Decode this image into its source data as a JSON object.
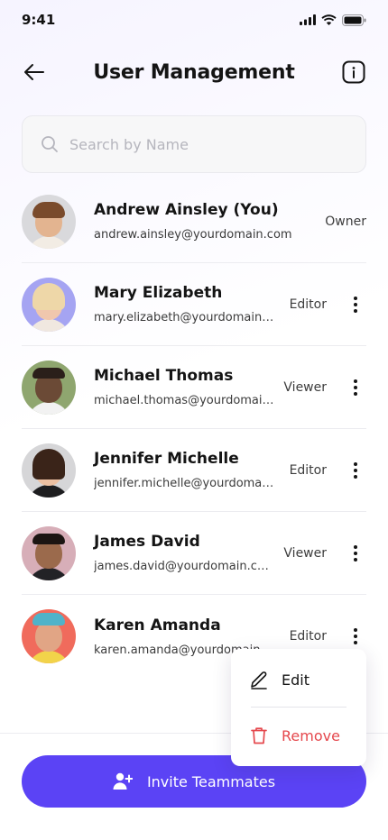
{
  "status_bar": {
    "time": "9:41",
    "icons": [
      "signal-icon",
      "wifi-icon",
      "battery-icon"
    ]
  },
  "header": {
    "title": "User Management",
    "back_icon": "arrow-left-icon",
    "info_icon": "info-icon"
  },
  "search": {
    "placeholder": "Search by Name",
    "value": "",
    "icon": "search-icon"
  },
  "users": [
    {
      "name": "Andrew Ainsley (You)",
      "email": "andrew.ainsley@yourdomain.com",
      "role": "Owner",
      "has_menu": false,
      "avatar_bg": "#d9d9dc"
    },
    {
      "name": "Mary Elizabeth",
      "email": "mary.elizabeth@yourdomain.com",
      "role": "Editor",
      "has_menu": true,
      "avatar_bg": "#a5a4f2"
    },
    {
      "name": "Michael Thomas",
      "email": "michael.thomas@yourdomain.com",
      "role": "Viewer",
      "has_menu": true,
      "avatar_bg": "#8fa66f"
    },
    {
      "name": "Jennifer Michelle",
      "email": "jennifer.michelle@yourdomain.com",
      "role": "Editor",
      "has_menu": true,
      "avatar_bg": "#d6d6d8"
    },
    {
      "name": "James David",
      "email": "james.david@yourdomain.com",
      "role": "Viewer",
      "has_menu": true,
      "avatar_bg": "#d7aeb8"
    },
    {
      "name": "Karen Amanda",
      "email": "karen.amanda@yourdomain.com",
      "role": "Editor",
      "has_menu": true,
      "avatar_bg": "#f06b5c"
    }
  ],
  "context_menu": {
    "edit_label": "Edit",
    "edit_icon": "pencil-icon",
    "remove_label": "Remove",
    "remove_icon": "trash-icon"
  },
  "footer": {
    "invite_label": "Invite Teammates",
    "invite_icon": "user-plus-icon"
  },
  "colors": {
    "accent": "#5b43f5",
    "danger": "#e5484d",
    "text": "#141414",
    "muted": "#b5b5bd"
  }
}
